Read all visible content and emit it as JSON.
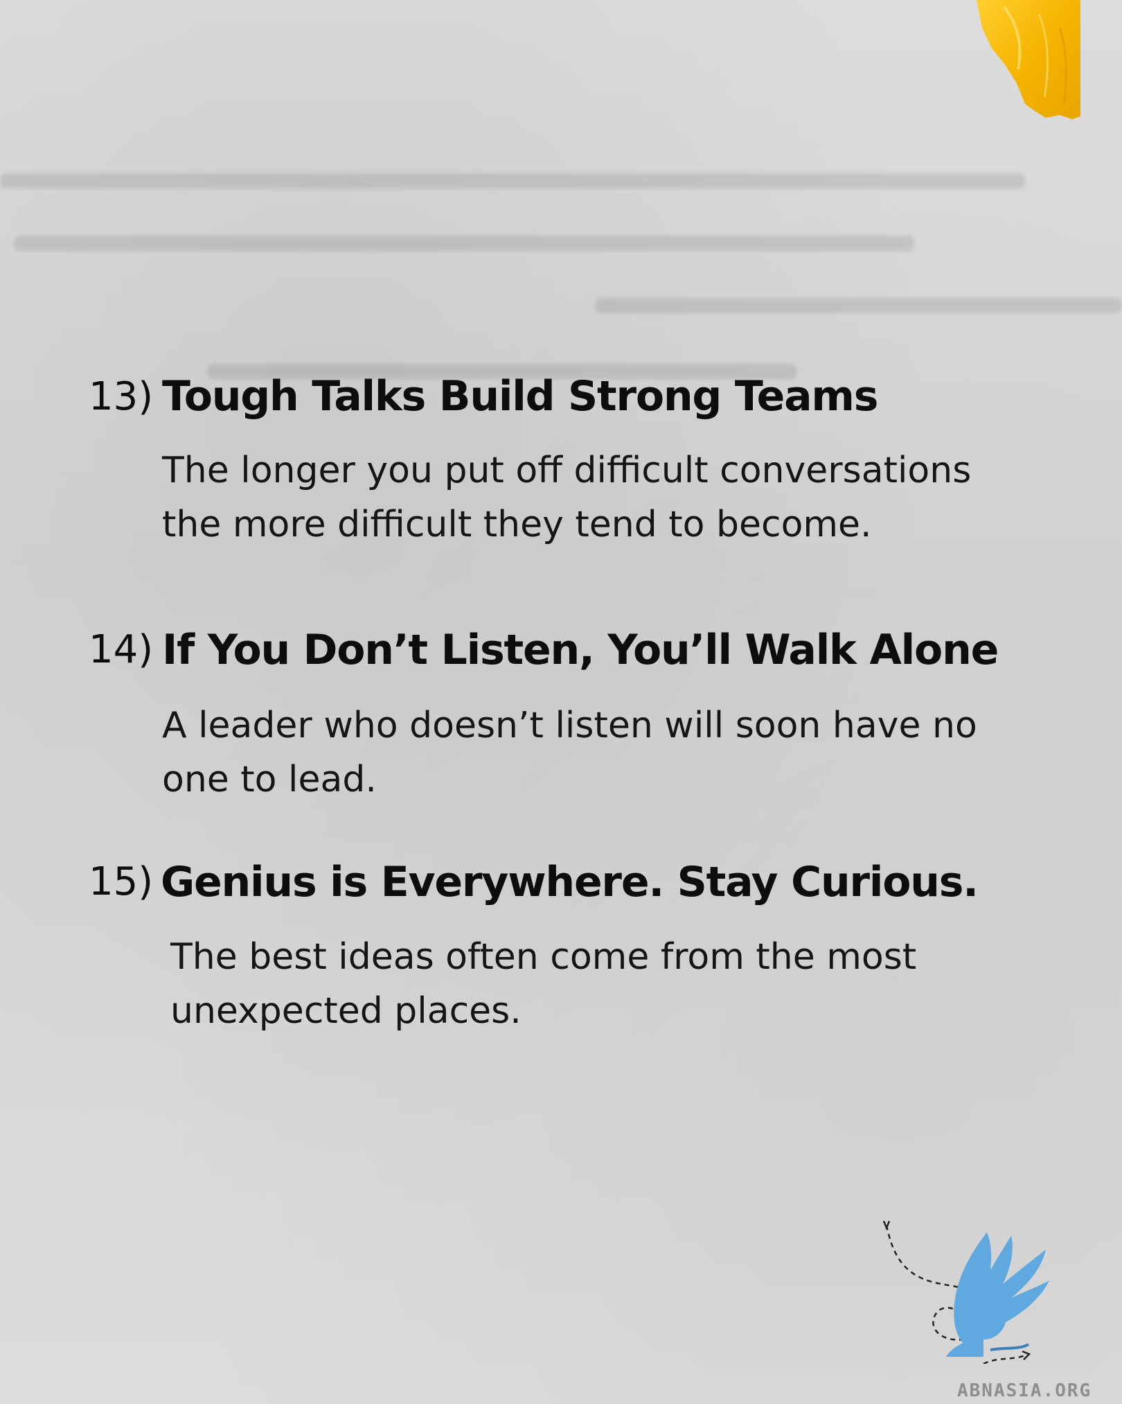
{
  "items": [
    {
      "number": "13)",
      "title": "Tough Talks Build Strong Teams",
      "body_lines": [
        "The longer you put off difficult conversations",
        "the more difficult they tend to become."
      ]
    },
    {
      "number": "14)",
      "title": "If You Don’t Listen, You’ll Walk Alone",
      "body_lines": [
        "A leader who doesn’t listen will soon have no",
        "one to lead."
      ]
    },
    {
      "number": "15)",
      "title": "Genius is Everywhere. Stay Curious.",
      "body_lines": [
        "The best ideas often come from the most",
        "unexpected places."
      ]
    }
  ],
  "brand": {
    "site": "ABNASIA.ORG",
    "logo_icon": "griffin-logo-icon"
  },
  "decor": {
    "tape_icon": "yellow-tape-icon",
    "tape_color": "#f5b400",
    "logo_color": "#5fa9e0"
  }
}
